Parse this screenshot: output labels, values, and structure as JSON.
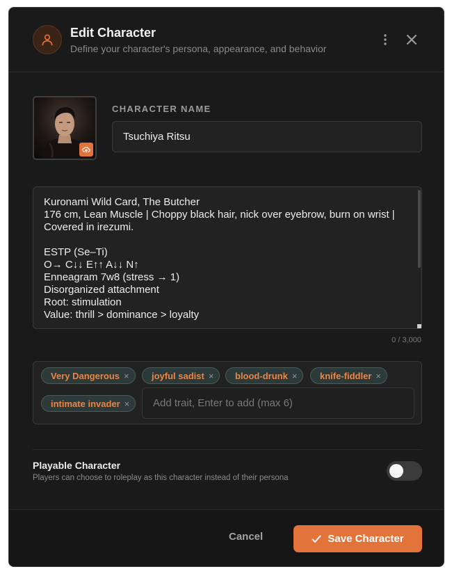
{
  "header": {
    "title": "Edit Character",
    "subtitle": "Define your character's persona, appearance, and behavior",
    "icon": "user-icon"
  },
  "colors": {
    "accent": "#e2733b",
    "background": "#1a1a1a",
    "chip_bg": "#2c3a3a"
  },
  "character": {
    "name_label": "CHARACTER NAME",
    "name_value": "Tsuchiya Ritsu",
    "avatar": "character-portrait",
    "description": "Kuronami Wild Card, The Butcher\n176 cm, Lean Muscle | Choppy black hair, nick over eyebrow, burn on wrist | Covered in irezumi.\n\nESTP (Se–Ti)\nO→ C↓↓ E↑↑ A↓↓ N↑\nEnneagram 7w8 (stress → 1)\nDisorganized attachment\nRoot: stimulation\nValue: thrill > dominance > loyalty",
    "char_count": "0 / 3,000"
  },
  "traits": {
    "items": [
      "Very Dangerous",
      "joyful sadist",
      "blood-drunk",
      "knife-fiddler",
      "intimate invader"
    ],
    "remove_glyph": "×",
    "placeholder": "Add trait, Enter to add (max 6)"
  },
  "playable": {
    "title": "Playable Character",
    "description": "Players can choose to roleplay as this character instead of their persona",
    "enabled": false
  },
  "footer": {
    "cancel_label": "Cancel",
    "save_label": "Save Character"
  }
}
